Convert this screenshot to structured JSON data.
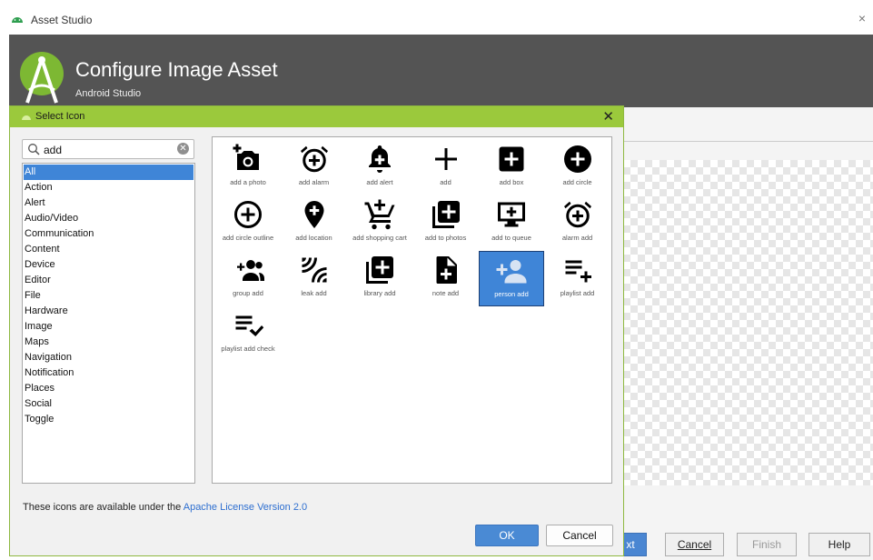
{
  "window": {
    "title": "Asset Studio",
    "close": "×"
  },
  "banner": {
    "title": "Configure Image Asset",
    "subtitle": "Android Studio"
  },
  "dialog": {
    "title": "Select Icon",
    "close": "✕",
    "search": {
      "value": "add",
      "clear": "✕"
    },
    "categories": [
      "All",
      "Action",
      "Alert",
      "Audio/Video",
      "Communication",
      "Content",
      "Device",
      "Editor",
      "File",
      "Hardware",
      "Image",
      "Maps",
      "Navigation",
      "Notification",
      "Places",
      "Social",
      "Toggle"
    ],
    "selected_category": "All",
    "icons": [
      {
        "label": "add a photo",
        "icon": "add-a-photo-icon"
      },
      {
        "label": "add alarm",
        "icon": "add-alarm-icon"
      },
      {
        "label": "add alert",
        "icon": "add-alert-icon"
      },
      {
        "label": "add",
        "icon": "add-icon"
      },
      {
        "label": "add box",
        "icon": "add-box-icon"
      },
      {
        "label": "add circle",
        "icon": "add-circle-icon"
      },
      {
        "label": "add circle outline",
        "icon": "add-circle-outline-icon"
      },
      {
        "label": "add location",
        "icon": "add-location-icon"
      },
      {
        "label": "add shopping cart",
        "icon": "add-shopping-cart-icon"
      },
      {
        "label": "add to photos",
        "icon": "add-to-photos-icon"
      },
      {
        "label": "add to queue",
        "icon": "add-to-queue-icon"
      },
      {
        "label": "alarm add",
        "icon": "alarm-add-icon"
      },
      {
        "label": "group add",
        "icon": "group-add-icon"
      },
      {
        "label": "leak add",
        "icon": "leak-add-icon"
      },
      {
        "label": "library add",
        "icon": "library-add-icon"
      },
      {
        "label": "note add",
        "icon": "note-add-icon"
      },
      {
        "label": "person add",
        "icon": "person-add-icon"
      },
      {
        "label": "playlist add",
        "icon": "playlist-add-icon"
      },
      {
        "label": "playlist add check",
        "icon": "playlist-add-check-icon"
      }
    ],
    "selected_icon": "person add",
    "license_prefix": "These icons are available under the ",
    "license_link": "Apache License Version 2.0",
    "ok_label": "OK",
    "cancel_label": "Cancel"
  },
  "outer_buttons": {
    "next": "xt",
    "cancel": "Cancel",
    "finish": "Finish",
    "help": "Help"
  },
  "colors": {
    "dialog_title_bar": "#9bc93c",
    "selection": "#3f85d7",
    "banner": "#545454",
    "link": "#2e6fd0"
  }
}
